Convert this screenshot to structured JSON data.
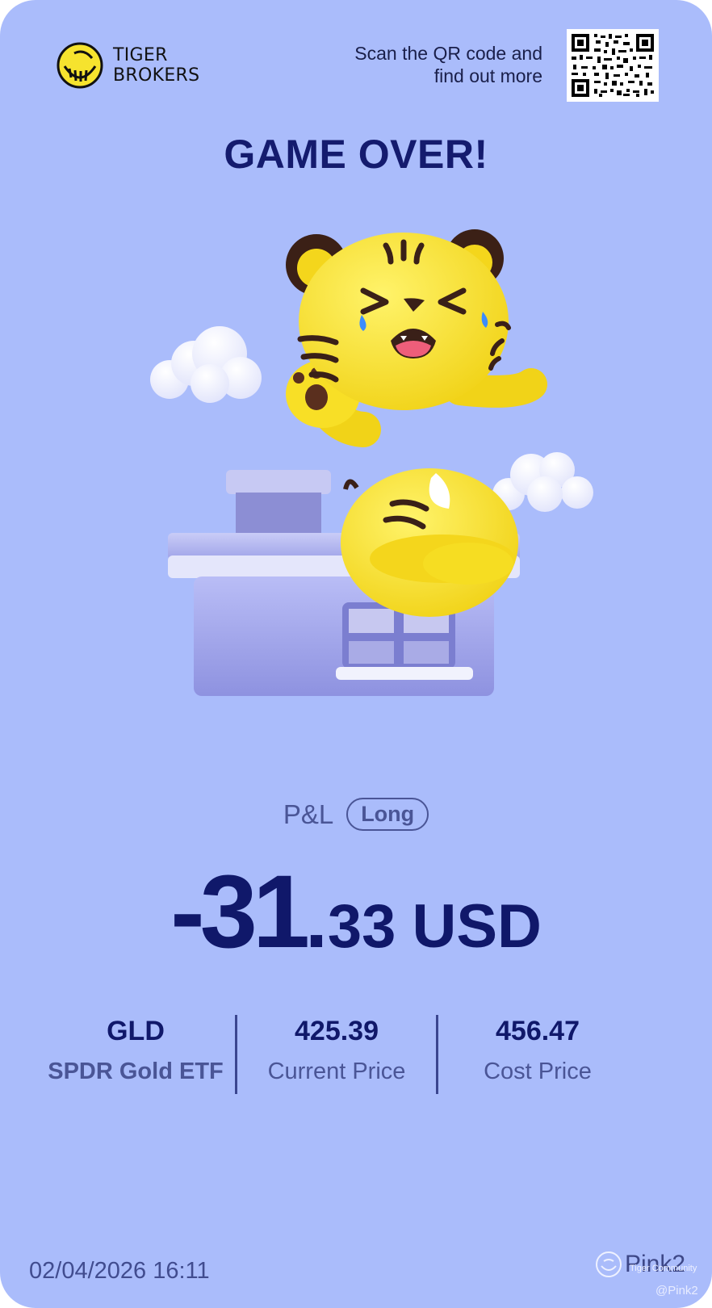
{
  "header": {
    "brand_line1": "TIGER",
    "brand_line2": "BROKERS",
    "scan_line1": "Scan the QR code and",
    "scan_line2": "find out more"
  },
  "title": "GAME OVER!",
  "pl": {
    "label": "P&L",
    "position_badge": "Long",
    "amount_integer": "-31",
    "amount_decimal_point": ".",
    "amount_fraction": "33",
    "currency": "USD"
  },
  "stats": [
    {
      "value": "GLD",
      "label": "SPDR Gold ETF"
    },
    {
      "value": "425.39",
      "label": "Current Price"
    },
    {
      "value": "456.47",
      "label": "Cost Price"
    }
  ],
  "footer": {
    "timestamp": "02/04/2026 16:11",
    "watermark_name": "Pink2",
    "watermark_small": "Tiger Community",
    "watermark_handle": "@Pink2"
  },
  "colors": {
    "background": "#aabcfb",
    "title": "#141b6e",
    "accent_yellow": "#f6e32e"
  },
  "icons": {
    "logo": "tiger-brokers-logo",
    "qr": "qr-code",
    "hero": "crying-tiger-on-house-illustration",
    "watermark": "community-watermark-icon"
  }
}
